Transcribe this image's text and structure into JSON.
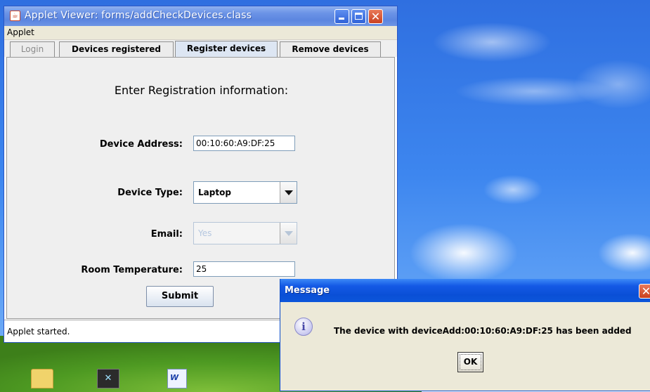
{
  "desktop": {
    "icons": [
      {
        "name": "folder-icon"
      },
      {
        "name": "excel-icon",
        "glyph": "✕"
      },
      {
        "name": "word-icon",
        "glyph": "W"
      }
    ]
  },
  "applet_window": {
    "title": "Applet Viewer: forms/addCheckDevices.class",
    "menu": {
      "applet": "Applet"
    },
    "tabs": [
      {
        "label": "Login",
        "state": "disabled"
      },
      {
        "label": "Devices registered",
        "state": "normal"
      },
      {
        "label": "Register devices",
        "state": "selected"
      },
      {
        "label": "Remove devices",
        "state": "normal"
      }
    ],
    "form": {
      "heading": "Enter Registration information:",
      "device_address": {
        "label": "Device Address:",
        "value": "00:10:60:A9:DF:25"
      },
      "device_type": {
        "label": "Device Type:",
        "value": "Laptop"
      },
      "email": {
        "label": "Email:",
        "value": "Yes",
        "enabled": false
      },
      "room_temperature": {
        "label": "Room Temperature:",
        "value": "25"
      },
      "submit_label": "Submit"
    },
    "status": "Applet started."
  },
  "message_dialog": {
    "title": "Message",
    "text": "The device with deviceAdd:00:10:60:A9:DF:25 has been added",
    "ok_label": "OK"
  },
  "glyphs": {
    "close": "✕",
    "java": "☕",
    "info": "i"
  },
  "colors": {
    "xp_titlebar": "#0a4fd6",
    "inactive_titlebar": "#6b93e6",
    "close_button": "#c9401f",
    "dialog_face": "#ece9d8",
    "panel_face": "#efefef",
    "field_border": "#7f9db9"
  }
}
